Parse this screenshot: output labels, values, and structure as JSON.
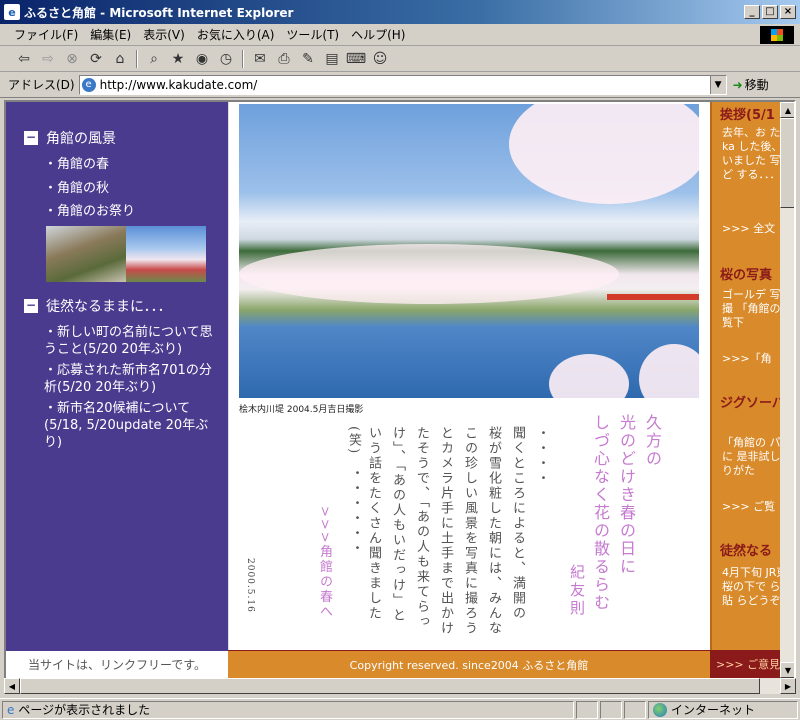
{
  "window": {
    "title": "ふるさと角館 - Microsoft Internet Explorer",
    "buttons": {
      "minimize": "_",
      "maximize": "□",
      "close": "×"
    }
  },
  "menu": [
    "ファイル(F)",
    "編集(E)",
    "表示(V)",
    "お気に入り(A)",
    "ツール(T)",
    "ヘルプ(H)"
  ],
  "toolbar": {
    "icons": [
      "back-icon",
      "forward-icon",
      "stop-icon",
      "refresh-icon",
      "home-icon",
      "search-icon",
      "favorites-icon",
      "media-icon",
      "history-icon",
      "mail-icon",
      "print-icon",
      "edit-icon",
      "discuss-icon",
      "research-icon",
      "messenger-icon"
    ]
  },
  "address": {
    "label": "アドレス(D)",
    "url": "http://www.kakudate.com/",
    "go": "移動"
  },
  "sidebar": {
    "section1": "角館の風景",
    "links1": [
      "・角館の春",
      "・角館の秋",
      "・角館のお祭り"
    ],
    "section2": "徒然なるままに．．．",
    "links2": [
      "・新しい町の名前について思うこと(5/20 20年ぶり)",
      "・応募された新市名701の分析(5/20 20年ぶり)",
      "・新市名20候補について(5/18, 5/20update 20年ぶり)"
    ]
  },
  "main": {
    "caption": "桧木内川堤 2004.5月吉日撮影",
    "poem_lines": [
      "久方の",
      "光のどけき春の日に",
      "しづ心なく花の散るらむ"
    ],
    "poem_author": "紀友則",
    "essay_lines": [
      "・・・・",
      "聞くところによると、満開の",
      "桜が雪化粧した朝には、みんな",
      "この珍しい風景を写真に撮ろう",
      "とカメラ片手に土手まで出かけ",
      "たそうで、「あの人も来てらっ",
      "け」、「あの人もいだっけ」と",
      "いう話をたくさん聞きました",
      "(笑)",
      "・・・・・・"
    ],
    "nav_link": ">>>角館の春へ",
    "date_stamp": "2000.5.16"
  },
  "right": {
    "head1": "挨拶(5/1",
    "text1": "去年、お た際にka した後、ほ ていました 写真など する．．．",
    "more1": ">>> 全文",
    "head2": "桜の写真",
    "text2": "ゴールデ 写真を撮 「角館の 非ご覧下",
    "more2": ">>>「角",
    "head3": "ジグソーパ",
    "text3": "「角館の パズルに 是非試し ばありがた",
    "more3": ">>> ご覧",
    "head4": "徒然なる",
    "text4": "4月下旬 JR東京駅 桜の下で らいに貼 らどうぞ"
  },
  "footer": {
    "left": "当サイトは、リンクフリーです。",
    "center": "Copyright reserved. since2004 ふるさと角館",
    "right": ">>> ご意見"
  },
  "status": {
    "text": "ページが表示されました",
    "zone": "インターネット"
  }
}
